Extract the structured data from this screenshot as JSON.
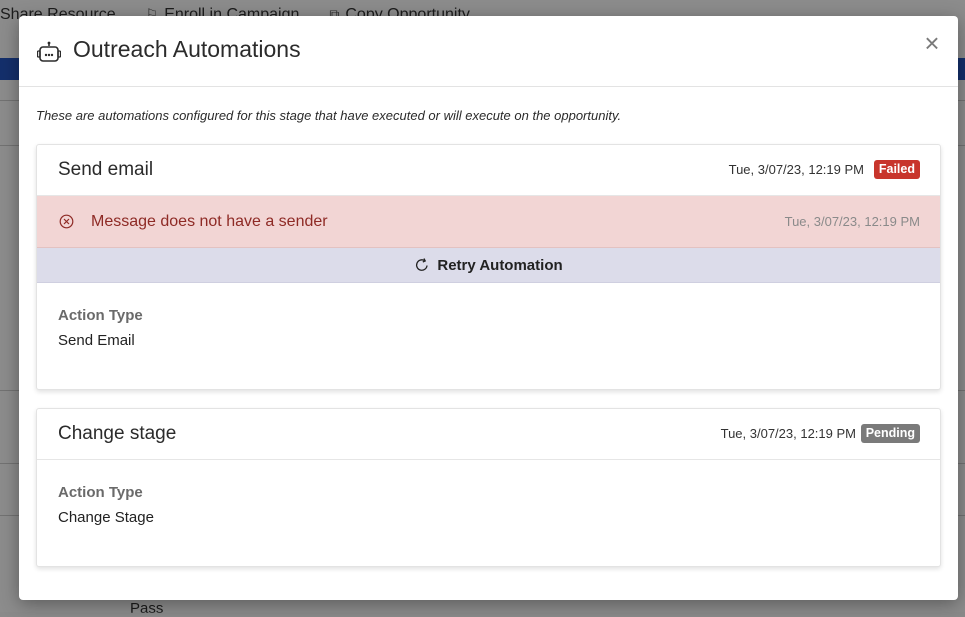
{
  "background": {
    "toolbar": [
      "Share Resource",
      "Enroll in Campaign",
      "Copy Opportunity"
    ],
    "bottom_text": "Pass"
  },
  "modal": {
    "title": "Outreach Automations",
    "close_symbol": "×",
    "description": "These are automations configured for this stage that have executed or will execute on the opportunity.",
    "automations": [
      {
        "title": "Send email",
        "timestamp": "Tue, 3/07/23, 12:19 PM",
        "status": "Failed",
        "status_color": "#c8352c",
        "error": {
          "message": "Message does not have a sender",
          "timestamp": "Tue, 3/07/23, 12:19 PM"
        },
        "retry_label": "Retry Automation",
        "field_label": "Action Type",
        "field_value": "Send Email"
      },
      {
        "title": "Change stage",
        "timestamp": "Tue, 3/07/23, 12:19 PM",
        "status": "Pending",
        "status_color": "#7a7a7a",
        "field_label": "Action Type",
        "field_value": "Change Stage"
      }
    ]
  }
}
